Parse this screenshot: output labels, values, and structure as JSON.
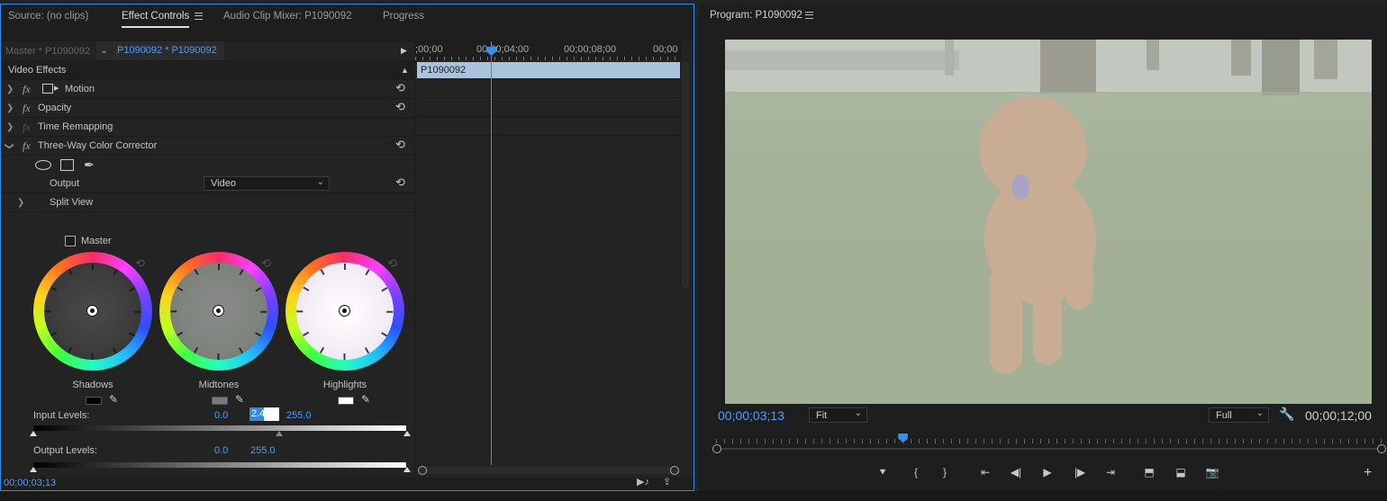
{
  "left_panel": {
    "tabs": [
      {
        "label": "Source: (no clips)"
      },
      {
        "label": "Effect Controls"
      },
      {
        "label": "Audio Clip Mixer: P1090092"
      },
      {
        "label": "Progress"
      }
    ],
    "source_master": "Master * P1090092",
    "source_sequence": "P1090092 * P1090092",
    "timeline": {
      "ruler": [
        ";00;00",
        "00;00;04;00",
        "00;00;08;00",
        "00;00"
      ],
      "clip_name": "P1090092"
    },
    "video_effects_header": "Video Effects",
    "effects": [
      {
        "name": "Motion"
      },
      {
        "name": "Opacity"
      },
      {
        "name": "Time Remapping"
      },
      {
        "name": "Three-Way Color Corrector"
      }
    ],
    "output": {
      "label": "Output",
      "value": "Video"
    },
    "split_view": "Split View",
    "master_label": "Master",
    "wheels": [
      {
        "label": "Shadows"
      },
      {
        "label": "Midtones"
      },
      {
        "label": "Highlights"
      }
    ],
    "input_levels": {
      "label": "Input Levels:",
      "low": "0.0",
      "mid": "2.4",
      "high": "255.0"
    },
    "output_levels": {
      "label": "Output Levels:",
      "low": "0.0",
      "high": "255.0"
    },
    "current_time": "00;00;03;13"
  },
  "program_monitor": {
    "title": "Program: P1090092",
    "current_time": "00;00;03;13",
    "zoom": "Fit",
    "resolution": "Full",
    "duration": "00;00;12;00",
    "playhead_progress": 0.28
  },
  "colors": {
    "accent": "#2d8ceb",
    "timecode_blue": "#4a9fff"
  }
}
